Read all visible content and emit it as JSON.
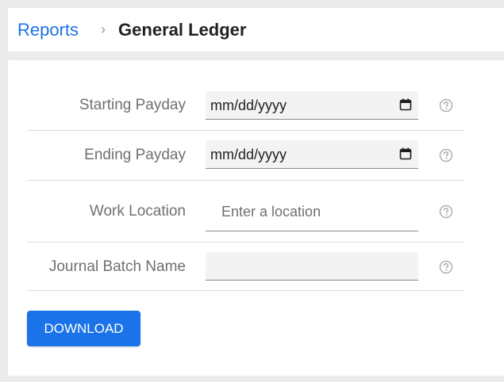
{
  "breadcrumb": {
    "parent": "Reports",
    "separator": "›",
    "current": "General Ledger"
  },
  "form": {
    "starting_payday": {
      "label": "Starting Payday",
      "value": "mm/dd/yyyy",
      "icon": "calendar-icon"
    },
    "ending_payday": {
      "label": "Ending Payday",
      "value": "mm/dd/yyyy",
      "icon": "calendar-icon"
    },
    "work_location": {
      "label": "Work Location",
      "placeholder": "Enter a location"
    },
    "journal_batch_name": {
      "label": "Journal Batch Name",
      "value": ""
    }
  },
  "help_icon": "help-circle-icon",
  "download_label": "DOWNLOAD",
  "colors": {
    "accent": "#1a73e8",
    "background": "#ebebeb",
    "label": "#707070"
  }
}
